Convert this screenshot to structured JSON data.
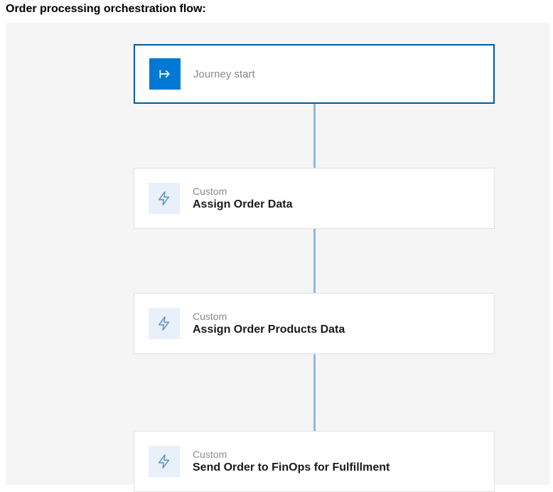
{
  "header": {
    "title": "Order processing orchestration flow:"
  },
  "flow": {
    "start": {
      "label": "Journey start",
      "icon_name": "arrow-right-icon"
    },
    "steps": [
      {
        "category": "Custom",
        "title": "Assign Order Data",
        "icon_name": "bolt-icon"
      },
      {
        "category": "Custom",
        "title": "Assign Order Products Data",
        "icon_name": "bolt-icon"
      },
      {
        "category": "Custom",
        "title": "Send Order to FinOps for Fulfillment",
        "icon_name": "bolt-icon"
      }
    ]
  },
  "colors": {
    "primary": "#0078d4",
    "primary_dark": "#005a9e",
    "connector": "#8fb8e0",
    "icon_bg_light": "#e8f0fa",
    "canvas_bg": "#f5f5f5"
  }
}
